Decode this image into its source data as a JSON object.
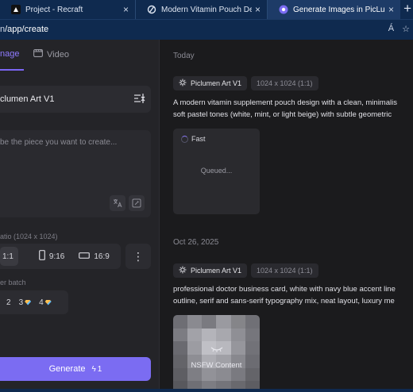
{
  "browser": {
    "tabs": [
      {
        "title": "Project - Recraft",
        "close": "×"
      },
      {
        "title": "Modern Vitamin Pouch Design Co",
        "close": "×"
      },
      {
        "title": "Generate Images in PicLumen",
        "close": "×"
      }
    ],
    "new_tab": "+",
    "url_host_partial": "n",
    "url_path": "/app/create",
    "reader_icon": "Á",
    "favorite_icon": "☆"
  },
  "left_panel": {
    "mode_tabs": {
      "image_partial": "nage",
      "video": "Video"
    },
    "model_name": "clumen Art V1",
    "prompt_placeholder": "be the piece you want to create...",
    "ratio_label": "atio (1024 x 1024)",
    "ratios": [
      {
        "label": "1:1",
        "selected": true
      },
      {
        "label": "9:16",
        "selected": false
      },
      {
        "label": "16:9",
        "selected": false
      }
    ],
    "more_icon": "⋮",
    "batch_label": "er batch",
    "batch_options": [
      {
        "label": "2",
        "premium": false
      },
      {
        "label": "3",
        "premium": true
      },
      {
        "label": "4",
        "premium": true
      }
    ],
    "generate": {
      "label": "Generate",
      "cost": "1",
      "bolt": "ϟ"
    }
  },
  "feed": {
    "groups": [
      {
        "day": "Today",
        "model": "Piclumen Art V1",
        "size": "1024 x 1024 (1:1)",
        "prompt_line1": "A modern vitamin supplement pouch design with a clean, minimalis",
        "prompt_line2": "soft pastel tones (white, mint, or light beige) with subtle geometric",
        "status_badge": "Fast",
        "status_text": "Queued..."
      },
      {
        "day": "Oct 26, 2025",
        "model": "Piclumen Art V1",
        "size": "1024 x 1024 (1:1)",
        "prompt_line1": "professional doctor business card, white with navy blue accent line",
        "prompt_line2": "outline, serif and sans-serif typography mix, neat layout, luxury me",
        "overlay_text": "NSFW Content"
      }
    ]
  },
  "colors": {
    "accent": "#7b6cf2",
    "browser_chrome": "#0f2a4f",
    "panel": "#242428",
    "feed_bg": "#1b1b1d"
  }
}
